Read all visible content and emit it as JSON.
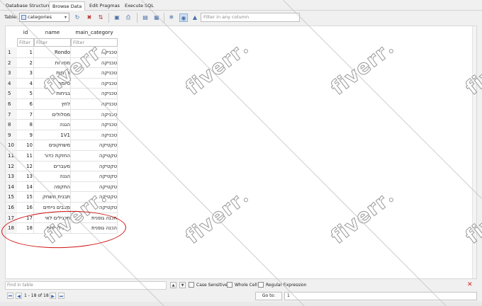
{
  "tabs": [
    {
      "label": "Database Structure"
    },
    {
      "label": "Browse Data"
    },
    {
      "label": "Edit Pragmas"
    },
    {
      "label": "Execute SQL"
    }
  ],
  "toolbar": {
    "table_label": "Table:",
    "table_value": "categories",
    "filter_placeholder": "Filter in any column"
  },
  "grid": {
    "columns": [
      "id",
      "name",
      "main_category"
    ],
    "filter_placeholder": "Filter",
    "rows": [
      {
        "n": "1",
        "id": "1",
        "name": "Rondo",
        "cat": "טכניקה"
      },
      {
        "n": "2",
        "id": "2",
        "name": "מסירות",
        "cat": "טכניקה"
      },
      {
        "n": "3",
        "id": "3",
        "name": "הרמות",
        "cat": "טכניקה"
      },
      {
        "n": "4",
        "id": "4",
        "name": "סיומת",
        "cat": "טכניקה"
      },
      {
        "n": "5",
        "id": "5",
        "name": "בגיחות",
        "cat": "טכניקה"
      },
      {
        "n": "6",
        "id": "6",
        "name": "לחץ",
        "cat": "טכניקה"
      },
      {
        "n": "7",
        "id": "7",
        "name": "מסלולים",
        "cat": "טכניקה"
      },
      {
        "n": "8",
        "id": "8",
        "name": "הגנה",
        "cat": "טכניקה"
      },
      {
        "n": "9",
        "id": "9",
        "name": "1V1",
        "cat": "טכניקה"
      },
      {
        "n": "10",
        "id": "10",
        "name": "משחקונים",
        "cat": "טקטיקה"
      },
      {
        "n": "11",
        "id": "11",
        "name": "החזקת כדור",
        "cat": "טקטיקה"
      },
      {
        "n": "12",
        "id": "12",
        "name": "מעברים",
        "cat": "טקטיקה"
      },
      {
        "n": "13",
        "id": "13",
        "name": "הגנה",
        "cat": "טקטיקה"
      },
      {
        "n": "14",
        "id": "14",
        "name": "התקפה",
        "cat": "טקטיקה"
      },
      {
        "n": "15",
        "id": "15",
        "name": "תבנית משחק",
        "cat": "טקטיקה"
      },
      {
        "n": "16",
        "id": "16",
        "name": "מצבים נייחים",
        "cat": "טקטיקה"
      },
      {
        "n": "17",
        "id": "17",
        "name": "תרגילים לאי",
        "cat": "הכנה גופנית"
      },
      {
        "n": "18",
        "id": "18",
        "name": "תרגילי סיום",
        "cat": "הכנה גופנית"
      }
    ]
  },
  "find": {
    "placeholder": "Find in table",
    "case_sensitive": "Case Sensitive",
    "whole_cell": "Whole Cell",
    "regex": "Regular Expression"
  },
  "nav": {
    "range_text": "1 - 18 of 18",
    "goto_label": "Go to:",
    "goto_value": "1"
  },
  "watermark": {
    "text": "fiverr"
  },
  "colors": {
    "annotation": "#d01010",
    "accent": "#2f5fb0"
  }
}
